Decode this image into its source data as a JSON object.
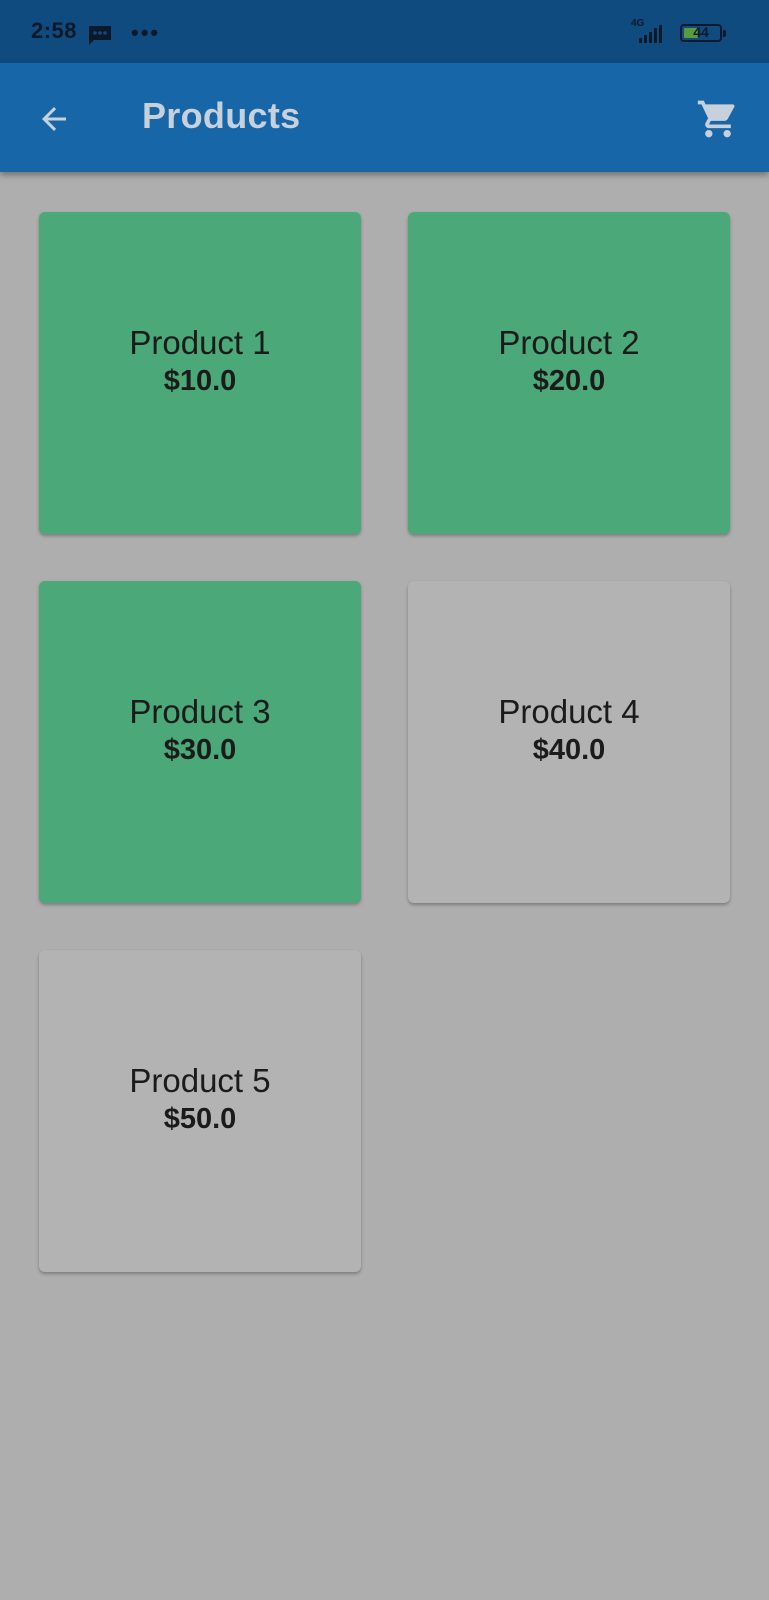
{
  "status_bar": {
    "time": "2:58",
    "network": "4G",
    "battery": "44",
    "more_icon": "more-dots-icon",
    "message_icon": "message-icon"
  },
  "app_bar": {
    "title": "Products",
    "back_icon": "arrow-back-icon",
    "cart_icon": "shopping-cart-icon"
  },
  "colors": {
    "app_bar": "#1766a8",
    "status_bar": "#0f4b7e",
    "selected_card": "#4ba878",
    "unselected_card": "#b3b3b3",
    "background": "#aeaeae"
  },
  "products": [
    {
      "name": "Product 1",
      "price": "$10.0",
      "selected": true
    },
    {
      "name": "Product 2",
      "price": "$20.0",
      "selected": true
    },
    {
      "name": "Product 3",
      "price": "$30.0",
      "selected": true
    },
    {
      "name": "Product 4",
      "price": "$40.0",
      "selected": false
    },
    {
      "name": "Product 5",
      "price": "$50.0",
      "selected": false
    }
  ]
}
